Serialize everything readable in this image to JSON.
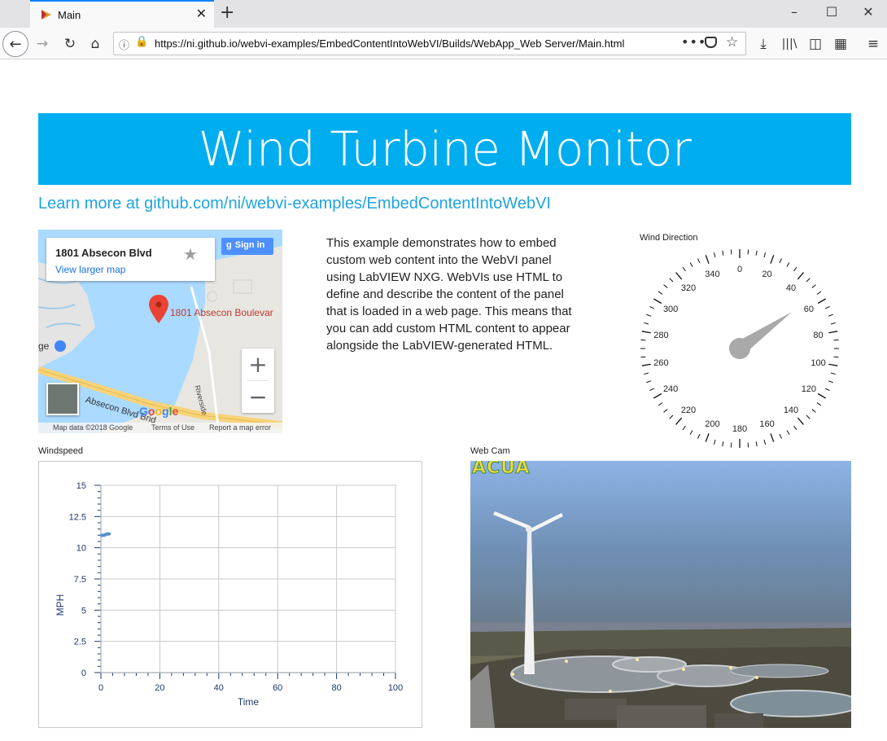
{
  "browser": {
    "tab_title": "Main",
    "url": "https://ni.github.io/webvi-examples/EmbedContentIntoWebVI/Builds/WebApp_Web Server/Main.html",
    "url_host": "ni.github.io",
    "icons": [
      "back-icon",
      "forward-icon",
      "reload-icon",
      "home-icon",
      "info-icon",
      "lock-warning-icon",
      "more-icon",
      "pocket-icon",
      "bookmark-star-icon",
      "download-icon",
      "library-icon",
      "sidebar-icon",
      "extensions-icon",
      "menu-icon"
    ]
  },
  "page": {
    "title": "Wind Turbine Monitor",
    "link_text": "Learn more at github.com/ni/webvi-examples/EmbedContentIntoWebVI",
    "description": "This example demonstrates how to embed custom web content into the WebVI panel using LabVIEW NXG. WebVIs use HTML to define and describe the content of the panel that is loaded in a web page. This means that you can add custom HTML content to appear alongside the LabVIEW-generated HTML.",
    "banner_color": "#00adef",
    "link_color": "#1fa3e0"
  },
  "map": {
    "place_name": "1801 Absecon Blvd",
    "view_larger": "View larger map",
    "sign_in": "Sign in",
    "pin_label": "1801 Absecon Boulevar",
    "road_label": "Absecon Blvd Brid",
    "side_road_label": "Riverside",
    "edge_label": "ge",
    "zoom_in": "+",
    "zoom_out": "−",
    "google_logo": "Google",
    "attribution": "Map data ©2018 Google",
    "terms": "Terms of Use",
    "report": "Report a map error"
  },
  "gauge": {
    "label": "Wind Direction",
    "min": 0,
    "max": 360,
    "tick_labels": [
      "0",
      "20",
      "40",
      "60",
      "80",
      "100",
      "120",
      "140",
      "160",
      "180",
      "200",
      "220",
      "240",
      "260",
      "280",
      "300",
      "320",
      "340"
    ],
    "needle_value": 55,
    "needle_color": "#a9a9a9"
  },
  "windspeed": {
    "label": "Windspeed"
  },
  "chart_data": {
    "type": "line",
    "xlabel": "Time",
    "ylabel": "MPH",
    "xlim": [
      0,
      100
    ],
    "ylim": [
      0,
      15
    ],
    "x_ticks": [
      "0",
      "20",
      "40",
      "60",
      "80",
      "100"
    ],
    "y_ticks": [
      "0",
      "2.5",
      "5",
      "7.5",
      "10",
      "12.5",
      "15"
    ],
    "grid": true,
    "series": [
      {
        "x": [
          0,
          1,
          2,
          3
        ],
        "values": [
          11.0,
          11.0,
          11.1,
          11.1
        ],
        "color": "#5b8fd1"
      }
    ]
  },
  "webcam": {
    "label": "Web Cam",
    "overlay_text": "ACUA"
  }
}
